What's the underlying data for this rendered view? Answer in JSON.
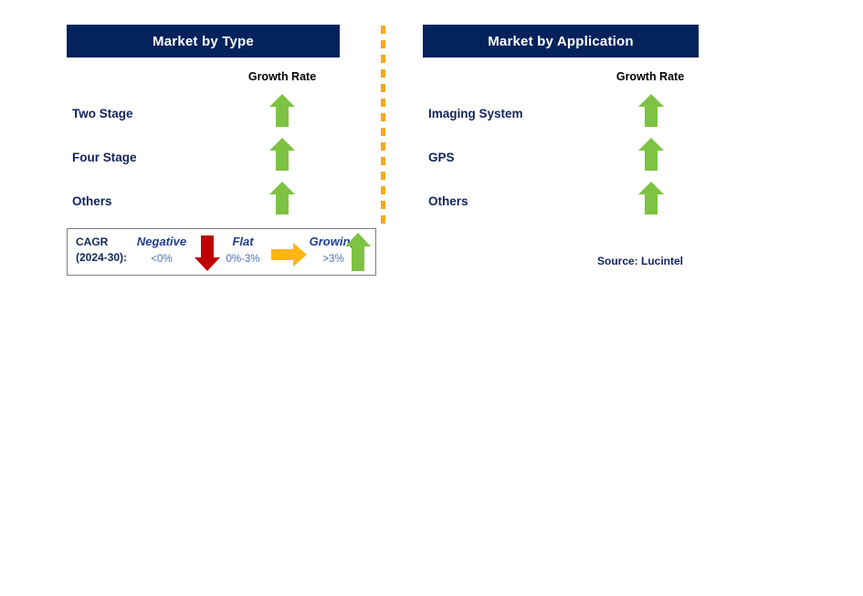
{
  "divider": {
    "color": "#f5a81c",
    "style": "dashed-vertical"
  },
  "panels": [
    {
      "id": "type",
      "title": "Market by Type",
      "column_header": "Growth Rate",
      "header_color": "#04235c",
      "rows": [
        {
          "label": "Two Stage",
          "growth": "growing",
          "icon": "arrow-up-icon",
          "color": "#7dc242"
        },
        {
          "label": "Four Stage",
          "growth": "growing",
          "icon": "arrow-up-icon",
          "color": "#7dc242"
        },
        {
          "label": "Others",
          "growth": "growing",
          "icon": "arrow-up-icon",
          "color": "#7dc242"
        }
      ]
    },
    {
      "id": "application",
      "title": "Market by Application",
      "column_header": "Growth Rate",
      "header_color": "#04235c",
      "rows": [
        {
          "label": "Imaging System",
          "growth": "growing",
          "icon": "arrow-up-icon",
          "color": "#7dc242"
        },
        {
          "label": "GPS",
          "growth": "growing",
          "icon": "arrow-up-icon",
          "color": "#7dc242"
        },
        {
          "label": "Others",
          "growth": "growing",
          "icon": "arrow-up-icon",
          "color": "#7dc242"
        }
      ]
    }
  ],
  "legend": {
    "title_line1": "CAGR",
    "title_line2": "(2024-30):",
    "items": [
      {
        "name": "Negative",
        "value": "<0%",
        "icon": "arrow-down-icon",
        "color": "#c00000"
      },
      {
        "name": "Flat",
        "value": "0%-3%",
        "icon": "arrow-right-icon",
        "color": "#ffb612"
      },
      {
        "name": "Growing",
        "value": ">3%",
        "icon": "arrow-up-icon",
        "color": "#7dc242"
      }
    ]
  },
  "source": "Source: Lucintel"
}
